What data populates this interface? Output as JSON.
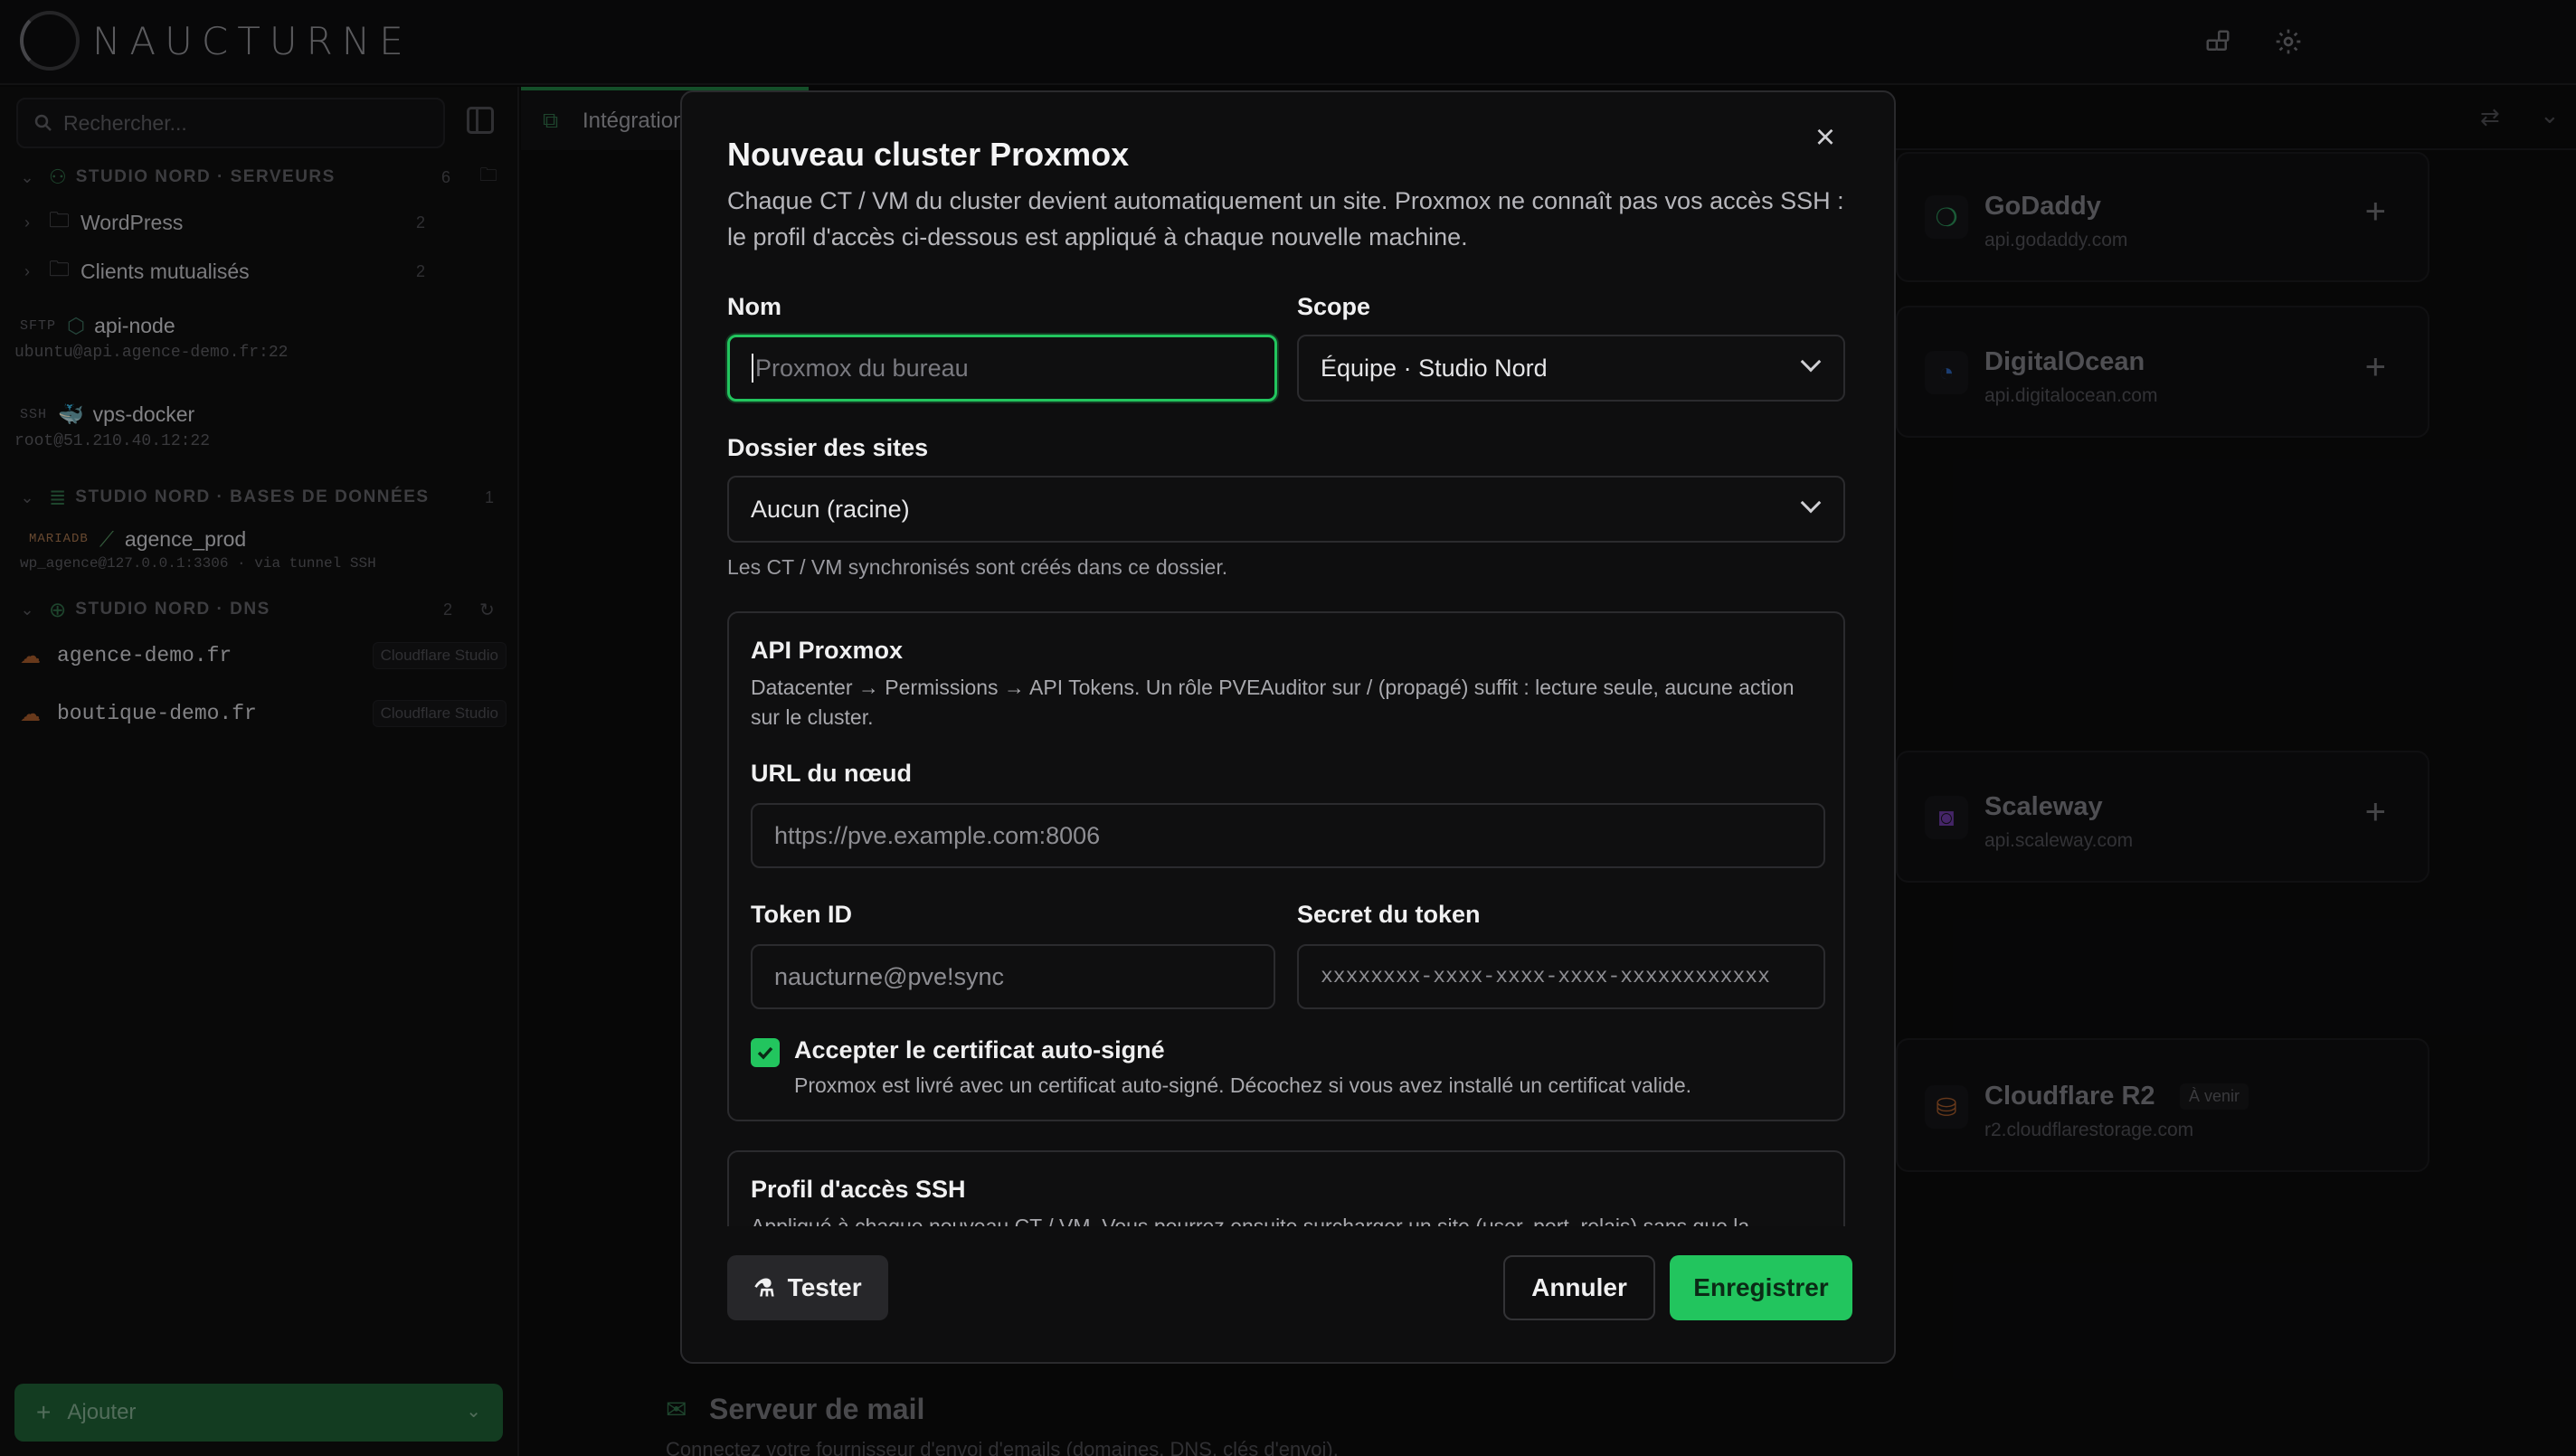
{
  "app": {
    "logo_text": "NAUCTURNE"
  },
  "sidebar": {
    "search_placeholder": "Rechercher...",
    "sections": [
      {
        "title": "STUDIO NORD · SERVEURS",
        "count": "6"
      },
      {
        "title": "STUDIO NORD · BASES DE DONNÉES",
        "count": "1"
      },
      {
        "title": "STUDIO NORD · DNS",
        "count": "2"
      }
    ],
    "folders": [
      {
        "label": "WordPress",
        "count": "2"
      },
      {
        "label": "Clients mutualisés",
        "count": "2"
      }
    ],
    "servers": [
      {
        "tag": "SFTP",
        "name": "api-node",
        "sub": "ubuntu@api.agence-demo.fr:22"
      },
      {
        "tag": "SSH",
        "name": "vps-docker",
        "sub": "root@51.210.40.12:22"
      }
    ],
    "databases": [
      {
        "tag": "MARIADB",
        "name": "agence_prod",
        "sub": "wp_agence@127.0.0.1:3306 · via tunnel SSH"
      }
    ],
    "dns": [
      {
        "name": "agence-demo.fr",
        "provider": "Cloudflare Studio"
      },
      {
        "name": "boutique-demo.fr",
        "provider": "Cloudflare Studio"
      }
    ],
    "add_label": "Ajouter"
  },
  "main": {
    "tab_label": "Intégrations",
    "cards": [
      {
        "title": "GoDaddy",
        "sub": "api.godaddy.com"
      },
      {
        "title": "DigitalOcean",
        "sub": "api.digitalocean.com"
      },
      {
        "title": "Scaleway",
        "sub": "api.scaleway.com"
      },
      {
        "title": "Cloudflare R2",
        "badge": "À venir",
        "sub": "r2.cloudflarestorage.com"
      }
    ],
    "mail_title": "Serveur de mail",
    "mail_desc": "Connectez votre fournisseur d'envoi d'emails (domaines, DNS, clés d'envoi)."
  },
  "modal": {
    "title": "Nouveau cluster Proxmox",
    "description": "Chaque CT / VM du cluster devient automatiquement un site. Proxmox ne connaît pas vos accès SSH : le profil d'accès ci-dessous est appliqué à chaque nouvelle machine.",
    "name_label": "Nom",
    "name_placeholder": "Proxmox du bureau",
    "scope_label": "Scope",
    "scope_value": "Équipe · Studio Nord",
    "folder_label": "Dossier des sites",
    "folder_value": "Aucun (racine)",
    "folder_hint": "Les CT / VM synchronisés sont créés dans ce dossier.",
    "api": {
      "title": "API Proxmox",
      "description": "Datacenter → Permissions → API Tokens. Un rôle PVEAuditor sur / (propagé) suffit : lecture seule, aucune action sur le cluster.",
      "url_label": "URL du nœud",
      "url_placeholder": "https://pve.example.com:8006",
      "token_id_label": "Token ID",
      "token_id_placeholder": "naucturne@pve!sync",
      "secret_label": "Secret du token",
      "secret_placeholder": "xxxxxxxx-xxxx-xxxx-xxxx-xxxxxxxxxxxx",
      "accept_cert_label": "Accepter le certificat auto-signé",
      "accept_cert_checked": true,
      "accept_cert_hint": "Proxmox est livré avec un certificat auto-signé. Décochez si vous avez installé un certificat valide."
    },
    "ssh": {
      "title": "Profil d'accès SSH",
      "description": "Appliqué à chaque nouveau CT / VM. Vous pourrez ensuite surcharger un site (user, port, relais) sans que la"
    },
    "test_label": "Tester",
    "cancel_label": "Annuler",
    "save_label": "Enregistrer"
  },
  "colors": {
    "accent": "#22c55e",
    "background": "#0b0b0c"
  }
}
